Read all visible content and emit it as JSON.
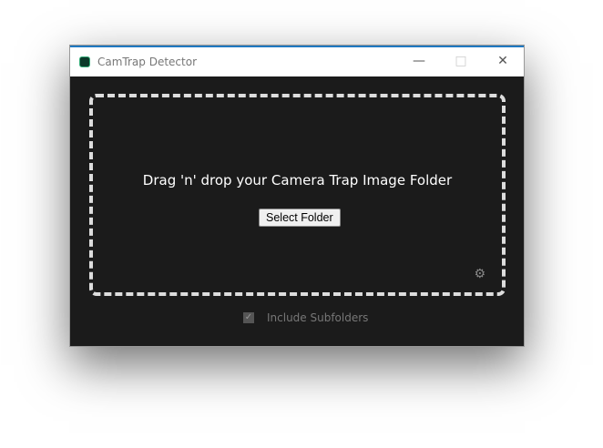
{
  "window": {
    "title": "CamTrap Detector"
  },
  "drop_zone": {
    "message": "Drag 'n' drop your Camera Trap Image Folder",
    "select_button": "Select Folder"
  },
  "options": {
    "include_subfolders_label": "Include Subfolders",
    "include_subfolders_checked": true
  }
}
